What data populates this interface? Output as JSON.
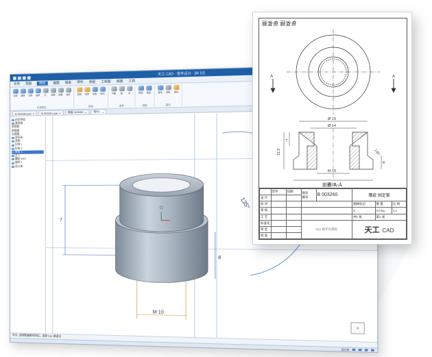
{
  "window": {
    "title": "天工 CAD · 零件设计 · [M 10]",
    "menus": [
      "文件",
      "草图",
      "特征",
      "曲面",
      "钣金",
      "焊件",
      "装配",
      "工程图",
      "视图",
      "工具"
    ],
    "active_menu": "特征"
  },
  "ribbon": {
    "groups": [
      {
        "label": "实体特征",
        "buttons": [
          "拉伸",
          "旋转",
          "扫掠",
          "放样",
          "孔",
          "倒角",
          "圆角",
          "抽壳"
        ]
      },
      {
        "label": "修改",
        "buttons": [
          "拔模",
          "加厚",
          "镜像",
          "阵列"
        ]
      },
      {
        "label": "参考",
        "buttons": [
          "平面",
          "轴",
          "点"
        ]
      },
      {
        "label": "测量",
        "buttons": [
          "距离",
          "角度"
        ]
      },
      {
        "label": "显示",
        "buttons": [
          "着色",
          "线框",
          "剖切"
        ]
      }
    ]
  },
  "doc_tabs": [
    "B 003260.par",
    "B 003261.par",
    "装配 003260",
    "零件1"
  ],
  "tree": {
    "nodes": [
      "历史特征",
      "基准面",
      "  前视图",
      "  俯视图",
      "  右视图",
      "坐标系",
      "草图",
      "拉伸 1",
      "拉伸 2",
      "倒角 1",
      "孔 1",
      "螺纹 M10",
      "旋转 1",
      "设计体"
    ],
    "selected_index": 9
  },
  "model_dims": {
    "height": "7",
    "right": "8",
    "angle": "135°",
    "thread": "M 10"
  },
  "command": {
    "prompt": "命令: 选择要编辑的特征，或按 Esc 键退出"
  },
  "status": {
    "text": "设计体"
  },
  "viewcube": {
    "label": "前"
  },
  "sheet": {
    "header": "鱼雀骊 鱼雀骊",
    "section_mark_left": "A",
    "section_mark_right": "A",
    "dims": {
      "d1": "Ø 19",
      "d2": "Ø 14",
      "h_left_outer": "11.5",
      "h_left_inner": "7",
      "h_right": "8",
      "chamfer": "135°",
      "thread": "M 10",
      "d3": "Ø 20"
    },
    "section_label": "剖面 A-A",
    "title_block": {
      "col_headers": [
        "签字",
        "日期"
      ],
      "row_labels": [
        "设 计",
        "校 对",
        "审 核",
        "工 艺",
        "标准化",
        "审 定",
        "批 准"
      ],
      "drawing_no_label": "图号",
      "drawing_no_sub": "编号",
      "drawing_no": "B 003260",
      "part_name": "镶嵌 固定套",
      "material_label": "图样标记",
      "weight_label": "重 量",
      "scale_label": "比 例",
      "version_label": "版 本",
      "material_value": "S",
      "weight_value": "0.0 kg",
      "scale_value": "1:1",
      "sheets_label": "共1 张",
      "sheet_no": "第1 张",
      "mid_note": "Dyn 数字化模板",
      "brand": "天工",
      "brand_suffix": "CAD"
    }
  }
}
